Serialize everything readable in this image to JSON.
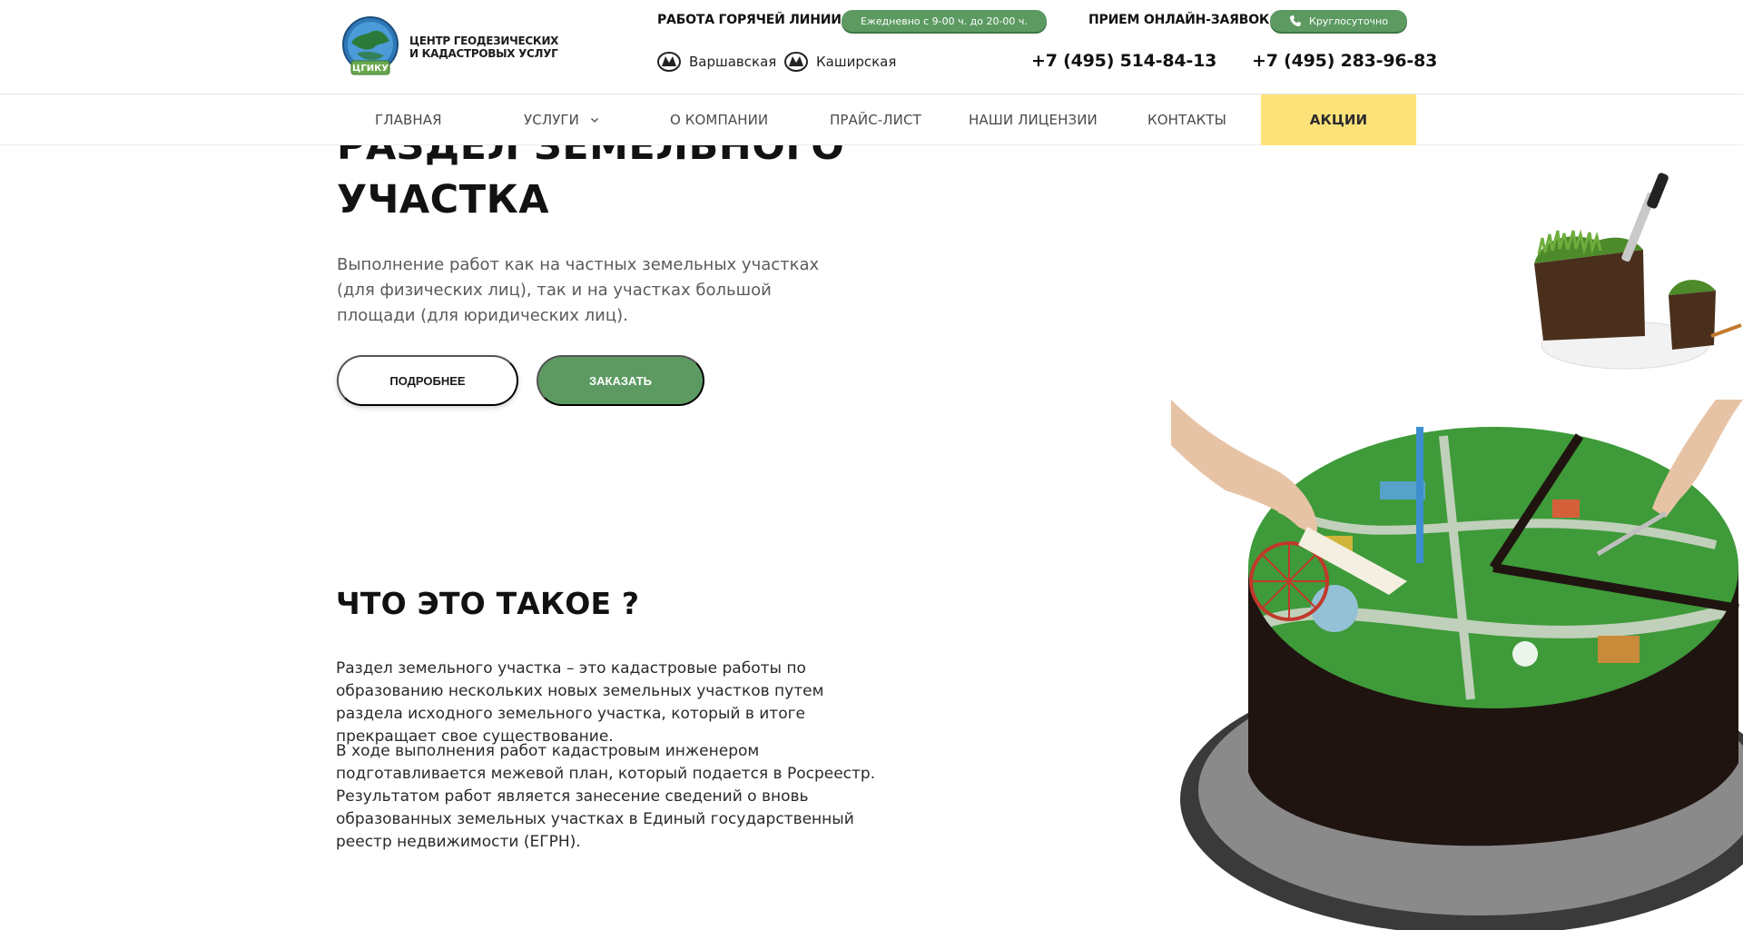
{
  "header": {
    "logo": {
      "badge_text": "ЦГИКУ",
      "line1": "ЦЕНТР ГЕОДЕЗИЧЕСКИХ",
      "line2": "И КАДАСТРОВЫХ УСЛУГ"
    },
    "hotline": {
      "label": "РАБОТА ГОРЯЧЕЙ ЛИНИИ:",
      "hours": "Ежедневно с 9-00 ч. до 20-00 ч."
    },
    "online": {
      "label": "ПРИЕМ ОНЛАЙН-ЗАЯВОК:",
      "hours": "Круглосуточно"
    },
    "metro": [
      "Варшавская",
      "Каширская"
    ],
    "phones": [
      "+7 (495) 514-84-13",
      "+7 (495) 283-96-83"
    ]
  },
  "nav": {
    "items": [
      "ГЛАВНАЯ",
      "УСЛУГИ",
      "О КОМПАНИИ",
      "ПРАЙС-ЛИСТ",
      "НАШИ ЛИЦЕНЗИИ",
      "КОНТАКТЫ",
      "АКЦИИ"
    ]
  },
  "hero": {
    "title_line1": "РАЗДЕЛ ЗЕМЕЛЬНОГО",
    "title_line2": "УЧАСТКА",
    "text": "Выполнение работ как на частных земельных участках (для физических лиц), так и на участках большой площади (для юридических лиц).",
    "btn_more": "ПОДРОБНЕЕ",
    "btn_order": "ЗАКАЗАТЬ"
  },
  "about": {
    "title": "ЧТО ЭТО ТАКОЕ ?",
    "p1": "Раздел земельного участка – это кадастровые работы по образованию нескольких новых земельных участков путем раздела исходного земельного участка, который в итоге прекращает свое существование.",
    "p2": "В ходе выполнения работ кадастровым инженером подготавливается межевой план, который подается в Росреестр. Результатом работ является занесение сведений о вновь образованных земельных участках в Единый государственный реестр недвижимости (ЕГРН)."
  },
  "colors": {
    "accent_green": "#5c9a62",
    "promo_yellow": "#fde27a"
  },
  "icons": [
    "metro-icon",
    "phone-icon",
    "chevron-down-icon"
  ]
}
